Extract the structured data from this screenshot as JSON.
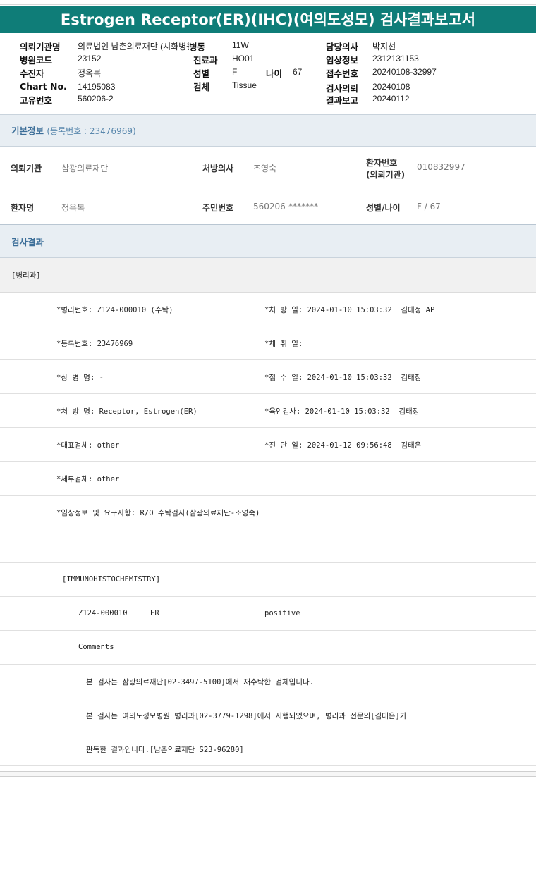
{
  "title": "Estrogen Receptor(ER)(IHC)(여의도성모) 검사결과보고서",
  "header": {
    "labels": {
      "org": "의뢰기관명",
      "ward": "병동",
      "doctor": "담당의사",
      "hosp_code": "병원코드",
      "dept": "진료과",
      "clinical": "임상정보",
      "patient": "수진자",
      "sex": "성별",
      "age": "나이",
      "reception": "접수번호",
      "chart": "Chart No.",
      "specimen": "검체",
      "request": "검사의뢰",
      "unique": "고유번호",
      "report": "결과보고"
    },
    "values": {
      "org": "의료법인 남촌의료재단 (시화병원)",
      "ward": "11W",
      "doctor": "박지선",
      "hosp_code": "23152",
      "dept": "HO01",
      "clinical": "2312131153",
      "patient": "정옥복",
      "sex": "F",
      "age": "67",
      "reception": "20240108-32997",
      "chart": "14195083",
      "specimen": "Tissue",
      "request": "20240108",
      "unique": "560206-2",
      "report": "20240112"
    }
  },
  "basic_info": {
    "title": "기본정보",
    "reg_no": "(등록번호 : 23476969)",
    "org_label": "의뢰기관",
    "org_value": "삼광의료재단",
    "doctor_label": "처방의사",
    "doctor_value": "조영숙",
    "pt_no_label_1": "환자번호",
    "pt_no_label_2": "(의뢰기관)",
    "pt_no_value": "010832997",
    "name_label": "환자명",
    "name_value": "정옥복",
    "rrn_label": "주민번호",
    "rrn_value": "560206-*******",
    "sexage_label": "성별/나이",
    "sexage_value": "F / 67"
  },
  "results": {
    "title": "검사결과",
    "dept_line": "[병리과]",
    "lines": [
      {
        "left": "*병리번호: Z124-000010 (수탁)",
        "right": "*처 방 일: 2024-01-10 15:03:32  김태정 AP"
      },
      {
        "left": "*등록번호: 23476969",
        "right": "*채 취 일:"
      },
      {
        "left": "*상 병 명: -",
        "right": "*접 수 일: 2024-01-10 15:03:32  김태정"
      },
      {
        "left": "*처 방 명: Receptor, Estrogen(ER)",
        "right": "*육안검사: 2024-01-10 15:03:32  김태정"
      },
      {
        "left": "*대표검체: other",
        "right": "*진 단 일: 2024-01-12 09:56:48  김태은"
      },
      {
        "left": "*세부검체: other",
        "right": ""
      },
      {
        "left": "*임상정보 및 요구사항: R/O 수탁검사(삼광의료재단-조영숙)",
        "right": ""
      }
    ],
    "ihc_header": "[IMMUNOHISTOCHEMISTRY]",
    "ihc_id": "Z124-000010",
    "ihc_marker": "ER",
    "ihc_result": "positive",
    "comments_label": "Comments",
    "comment_1": "본 검사는 삼광의료재단[02-3497-5100]에서 재수탁한 검체입니다.",
    "comment_2": "본 검사는 여의도성모병원 병리과[02-3779-1298]에서 시행되었으며, 병리과 전문의[김태은]가",
    "comment_3": "판독한 결과입니다.[남촌의료재단 S23-96280]"
  },
  "colors": {
    "title_bar": "#0f7d78",
    "section_bar": "#e8eef3",
    "section_text": "#3d6f99"
  }
}
